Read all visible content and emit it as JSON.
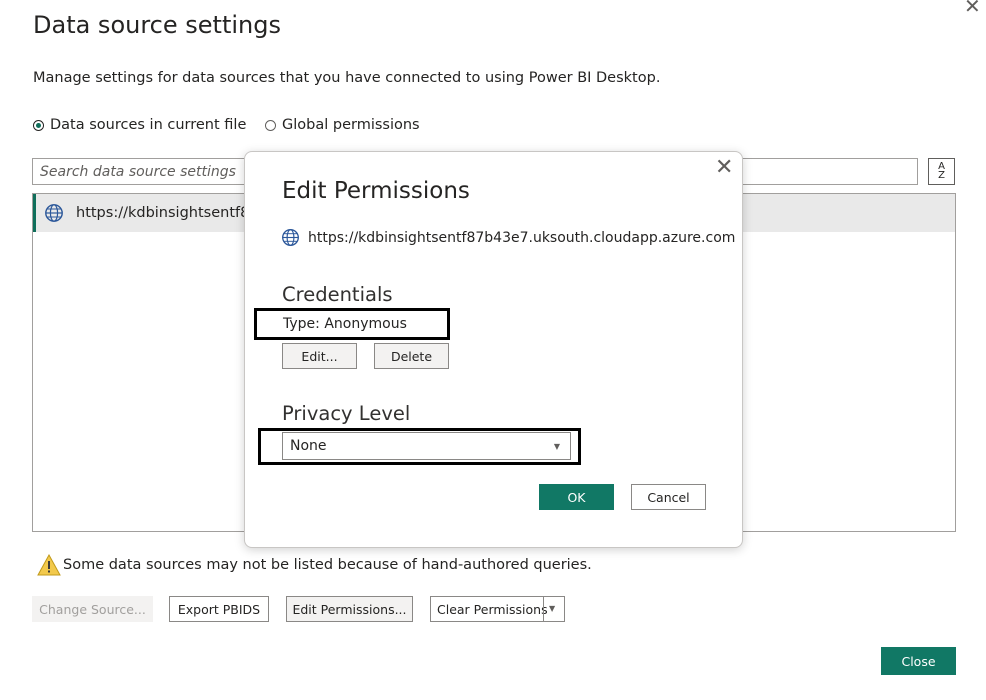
{
  "window": {
    "title": "Data source settings",
    "description": "Manage settings for data sources that you have connected to using Power BI Desktop."
  },
  "scope": {
    "options": [
      {
        "label": "Data sources in current file",
        "selected": true
      },
      {
        "label": "Global permissions",
        "selected": false
      }
    ]
  },
  "search": {
    "placeholder": "Search data source settings",
    "value": ""
  },
  "sort_icon_text": {
    "top": "A",
    "bottom": "Z"
  },
  "list": {
    "items": [
      {
        "label": "https://kdbinsightsentf8",
        "icon": "globe-icon"
      }
    ]
  },
  "warning": {
    "text": "Some data sources may not be listed because of hand-authored queries.",
    "icon": "warning-icon"
  },
  "actions": {
    "change_source": "Change Source...",
    "export_pbids": "Export PBIDS",
    "edit_permissions": "Edit Permissions...",
    "clear_permissions": "Clear Permissions",
    "close": "Close"
  },
  "edit_dialog": {
    "title": "Edit Permissions",
    "url": "https://kdbinsightsentf87b43e7.uksouth.cloudapp.azure.com",
    "credentials": {
      "heading": "Credentials",
      "type_text": "Type: Anonymous",
      "edit_label": "Edit...",
      "delete_label": "Delete"
    },
    "privacy": {
      "heading": "Privacy Level",
      "selected": "None"
    },
    "ok_label": "OK",
    "cancel_label": "Cancel"
  },
  "colors": {
    "accent": "#117865",
    "list_selected_bg": "#e9e9e9",
    "disabled_bg": "#f3f2f1"
  }
}
